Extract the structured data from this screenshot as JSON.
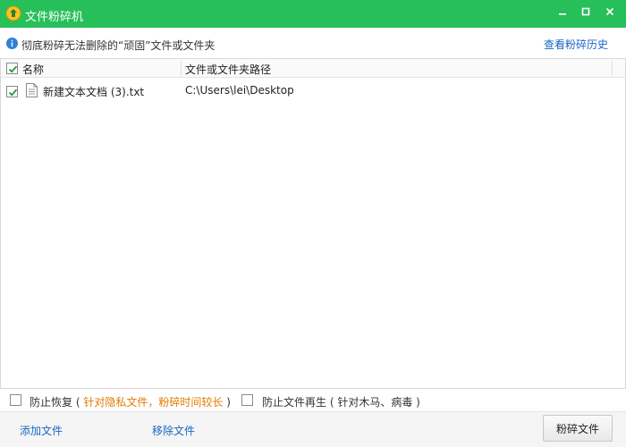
{
  "window": {
    "title": "文件粉碎机",
    "app_icon": "shredder-app-icon",
    "titlebar_color": "#27bf5a"
  },
  "info": {
    "text": "彻底粉碎无法删除的“顽固”文件或文件夹",
    "history_link": "查看粉碎历史"
  },
  "table": {
    "columns": [
      "名称",
      "文件或文件夹路径"
    ],
    "rows": [
      {
        "checked": true,
        "name": "新建文本文档 (3).txt",
        "path": "C:\\Users\\lei\\Desktop"
      }
    ]
  },
  "options": {
    "prevent_recovery": {
      "checked": false,
      "label": "防止恢复",
      "paren_open": "(",
      "note": "针对隐私文件，粉碎时间较长",
      "paren_close": ")"
    },
    "prevent_regen": {
      "checked": false,
      "label": "防止文件再生",
      "note": "( 针对木马、病毒 )"
    }
  },
  "footer": {
    "add_file": "添加文件",
    "remove_file": "移除文件",
    "shred_button": "粉碎文件"
  },
  "colors": {
    "accent": "#27bf5a",
    "link": "#1a66c2",
    "warning_text": "#e07b00"
  }
}
